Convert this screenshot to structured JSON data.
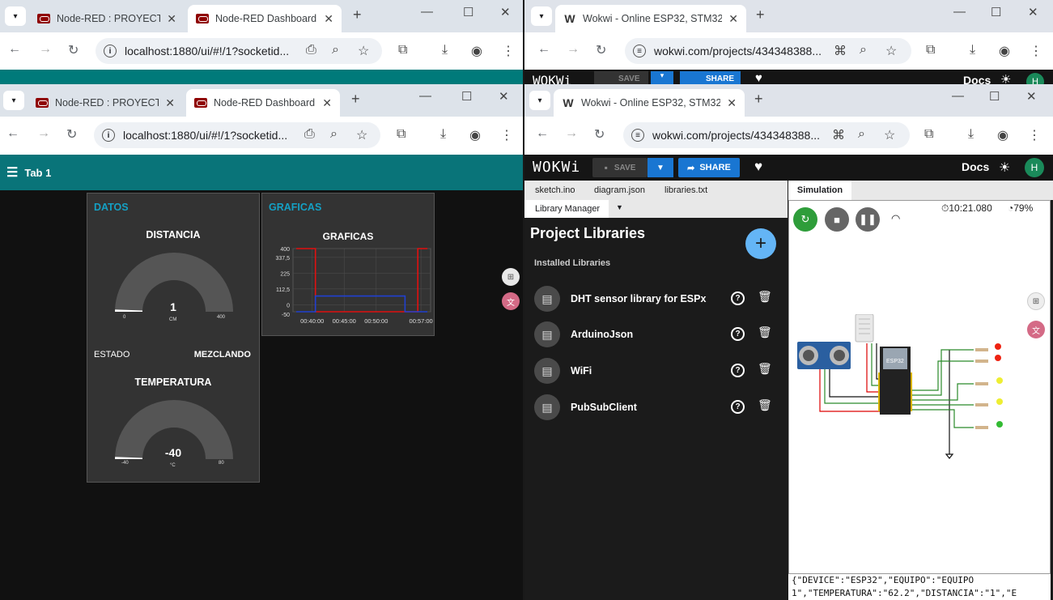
{
  "left_back": {
    "tabs": [
      {
        "title": "Node-RED : PROYECTO"
      },
      {
        "title": "Node-RED Dashboard"
      }
    ],
    "url": "localhost:1880/ui/#!/1?socketid..."
  },
  "left_front": {
    "tabs": [
      {
        "title": "Node-RED : PROYECTO"
      },
      {
        "title": "Node-RED Dashboard"
      }
    ],
    "url": "localhost:1880/ui/#!/1?socketid..."
  },
  "right_back": {
    "tabs": [
      {
        "title": "Wokwi - Online ESP32, STM32, A"
      }
    ],
    "url": "wokwi.com/projects/434348388...",
    "toolbar": {
      "logo": "WOKWi",
      "save": "SAVE",
      "share": "SHARE",
      "docs": "Docs",
      "avatar": "H"
    }
  },
  "right_front": {
    "tabs": [
      {
        "title": "Wokwi - Online ESP32, STM32, A"
      }
    ],
    "url": "wokwi.com/projects/434348388..."
  },
  "dashboard": {
    "tab_label": "Tab 1",
    "datos": {
      "header": "DATOS",
      "distancia": {
        "title": "DISTANCIA",
        "value": "1",
        "unit": "CM",
        "min": "0",
        "max": "400",
        "level": 0.0025
      },
      "estado": {
        "label": "ESTADO",
        "value": "MEZCLANDO"
      },
      "temperatura": {
        "title": "TEMPERATURA",
        "value": "-40",
        "unit": "°C",
        "min": "-40",
        "max": "80",
        "level": 0.0
      }
    },
    "graficas": {
      "header": "GRAFICAS",
      "title": "GRAFICAS"
    }
  },
  "chart_data": {
    "type": "line",
    "title": "GRAFICAS",
    "y_ticks": [
      "400",
      "337,5",
      "225",
      "112,5",
      "0",
      "-50"
    ],
    "x_ticks": [
      "00:40:00",
      "00:45:00",
      "00:50:00",
      "00:57:00"
    ],
    "ylim": [
      -50,
      400
    ],
    "xlim": [
      "00:37:00",
      "00:58:30"
    ],
    "grid": true,
    "series": [
      {
        "color": "#e01010",
        "points": [
          [
            "00:37:30",
            400
          ],
          [
            "00:40:30",
            400
          ],
          [
            "00:40:30",
            -50
          ],
          [
            "00:56:30",
            -50
          ],
          [
            "00:56:30",
            400
          ],
          [
            "00:58:00",
            400
          ]
        ]
      },
      {
        "color": "#2040d0",
        "points": [
          [
            "00:37:30",
            -50
          ],
          [
            "00:40:30",
            -50
          ],
          [
            "00:40:30",
            62
          ],
          [
            "00:54:30",
            62
          ],
          [
            "00:54:30",
            -50
          ],
          [
            "00:58:00",
            -50
          ]
        ]
      }
    ]
  },
  "wokwi": {
    "file_tabs": [
      "sketch.ino",
      "diagram.json",
      "libraries.txt"
    ],
    "library_tab": "Library Manager",
    "panel_title": "Project Libraries",
    "installed_label": "Installed Libraries",
    "libraries": [
      "DHT sensor library for ESPx",
      "ArduinoJson",
      "WiFi",
      "PubSubClient"
    ],
    "sim_tab": "Simulation",
    "timer": "10:21.080",
    "speed": "79%",
    "esp_label": "ESP32",
    "serial_lines": [
      "{\"DEVICE\":\"ESP32\",\"EQUIPO\":\"EQUIPO",
      "1\",\"TEMPERATURA\":\"62.2\",\"DISTANCIA\":\"1\",\"E"
    ]
  },
  "colors": {
    "teal": "#097479",
    "accent": "#14a0c4",
    "wokwi_blue": "#1976d2"
  }
}
